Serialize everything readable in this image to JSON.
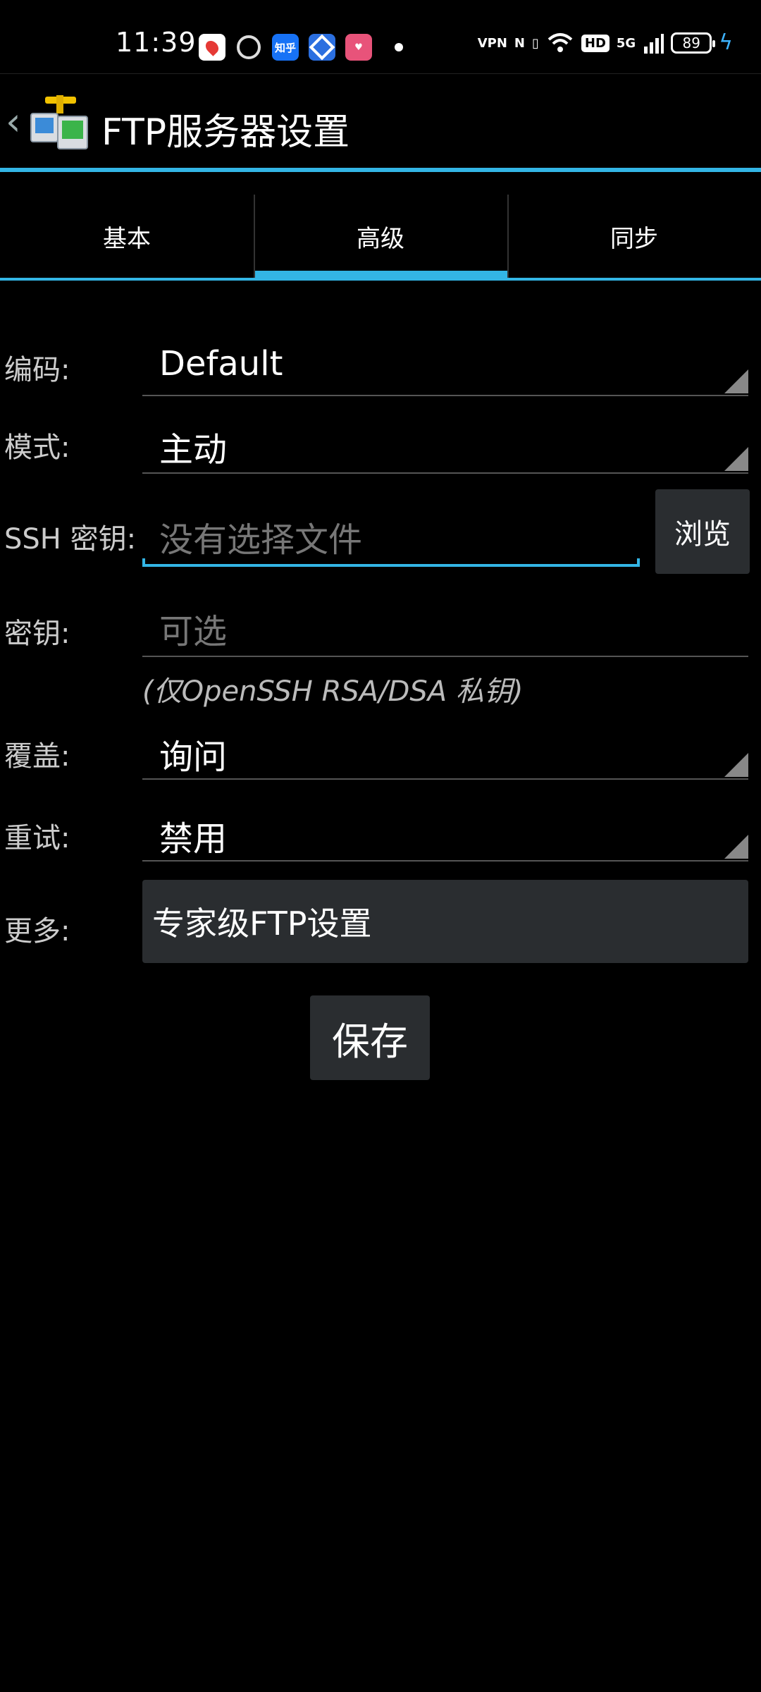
{
  "status_bar": {
    "time": "11:39",
    "notifications": [
      "maps-icon",
      "alien-icon",
      "zhihu-icon",
      "bank-icon",
      "pink-app-icon"
    ],
    "zhihu_label": "知乎",
    "vpn_label": "VPN",
    "hd_label": "HD",
    "network_label": "5G",
    "battery_level": "89"
  },
  "header": {
    "title": "FTP服务器设置"
  },
  "tabs": [
    {
      "label": "基本",
      "active": false
    },
    {
      "label": "高级",
      "active": true
    },
    {
      "label": "同步",
      "active": false
    }
  ],
  "form": {
    "encoding": {
      "label": "编码:",
      "value": "Default"
    },
    "mode": {
      "label": "模式:",
      "value": "主动"
    },
    "ssh_key": {
      "label": "SSH 密钥:",
      "placeholder": "没有选择文件",
      "browse_label": "浏览"
    },
    "passphrase": {
      "label": "密钥:",
      "placeholder": "可选"
    },
    "note": "(仅OpenSSH RSA/DSA 私钥)",
    "overwrite": {
      "label": "覆盖:",
      "value": "询问"
    },
    "retry": {
      "label": "重试:",
      "value": "禁用"
    },
    "more": {
      "label": "更多:",
      "button_label": "专家级FTP设置"
    }
  },
  "actions": {
    "save_label": "保存"
  },
  "colors": {
    "accent": "#33b5e5",
    "background": "#000000",
    "button": "#2a2d30"
  }
}
